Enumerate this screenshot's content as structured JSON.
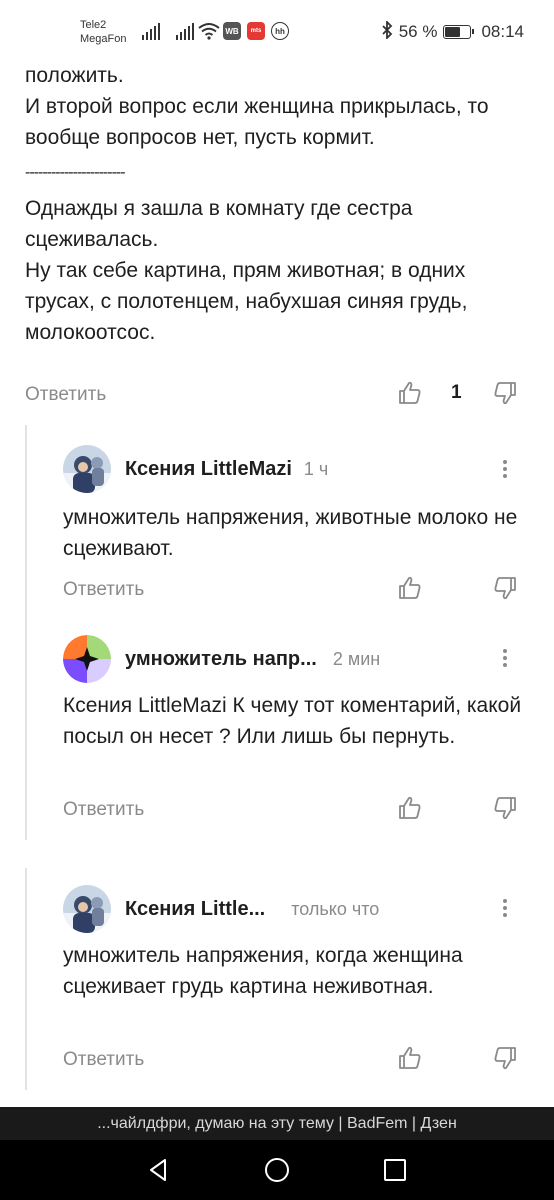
{
  "status_bar": {
    "carrier_1": "Tele2",
    "carrier_2": "MegaFon",
    "badge_wb": "WB",
    "badge_app": "mts",
    "badge_hh": "hh",
    "battery_percent_text": "56 %",
    "battery_level": 0.56,
    "time": "08:14"
  },
  "post": {
    "text": "положить.\nИ второй вопрос если женщина прикрылась, то вообще вопросов нет, пусть кормит.",
    "divider": "-----------------------",
    "text2": "Однажды я зашла в комнату где сестра сцеживалась.\nНу так себе картина, прям животная; в одних трусах, с полотенцем, набухшая синяя грудь, молокоотсос.",
    "reply_label": "Ответить",
    "like_count": "1"
  },
  "comments": [
    {
      "author": "Ксения LittleMazi",
      "time": "1 ч",
      "text": "умножитель напряжения, животные молоко не сцеживают.",
      "reply_label": "Ответить"
    },
    {
      "author": "умножитель напр...",
      "time": "2 мин",
      "text": "Ксения LittleMazi К чему тот коментарий, какой посыл он несет ? Или лишь бы пернуть.",
      "reply_label": "Ответить"
    },
    {
      "author": "Ксения Little...",
      "time": "только что",
      "text": "умножитель напряжения, когда женщина сцеживает грудь картина неживотная.",
      "reply_label": "Ответить"
    }
  ],
  "bottom_banner": "...чайлдфри, думаю на эту тему | BadFem | Дзен",
  "colors": {
    "text": "#1f1f1f",
    "muted": "#8a8a8a",
    "thread_line": "#e3e3e3",
    "banner_bg": "#1a1a1a",
    "navbar_bg": "#000000"
  },
  "icons": [
    "signal-icon",
    "wifi-icon",
    "bluetooth-icon",
    "battery-icon",
    "thumbs-up-icon",
    "thumbs-down-icon",
    "more-vertical-icon",
    "back-icon",
    "home-icon",
    "recents-icon"
  ]
}
